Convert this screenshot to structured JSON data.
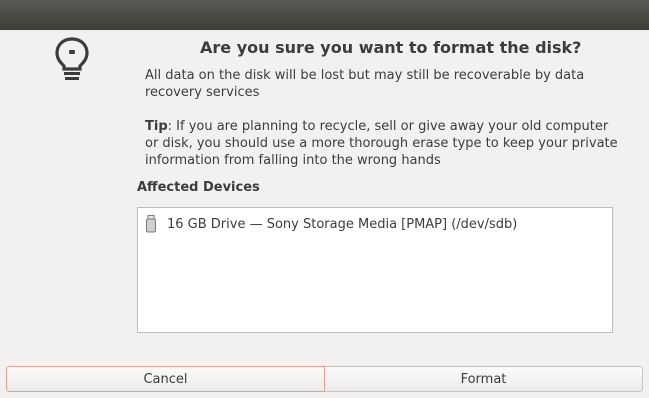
{
  "dialog": {
    "title": "Are you sure you want to format the disk?",
    "message": "All data on the disk will be lost but may still be recoverable by data recovery services",
    "tip": {
      "label": "Tip",
      "text": ": If you are planning to recycle, sell or give away your old computer or disk, you should use a more thorough erase type to keep your private information from falling into the wrong hands"
    },
    "icon": "lightbulb-icon"
  },
  "affected_devices": {
    "title": "Affected Devices",
    "items": [
      {
        "icon": "usb-drive-icon",
        "label": "16 GB Drive — Sony Storage Media [PMAP] (/dev/sdb)"
      }
    ]
  },
  "buttons": {
    "cancel": "Cancel",
    "format": "Format"
  },
  "colors": {
    "background": "#f2f1f0",
    "titlebar": "#4a4844",
    "text": "#3c3c3c",
    "focus_border": "#e3a08f"
  }
}
